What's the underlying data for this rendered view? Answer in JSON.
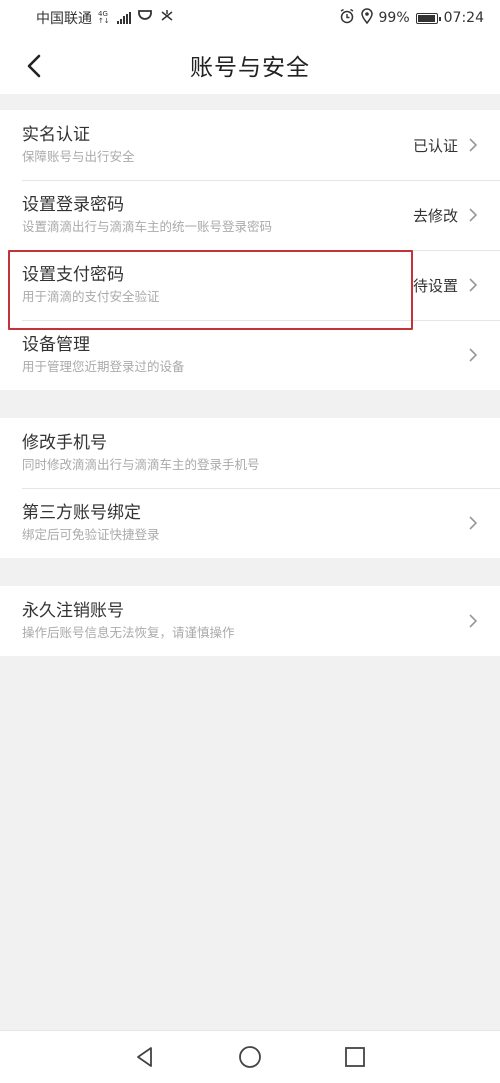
{
  "status_bar": {
    "carrier": "中国联通",
    "net_top": "4G",
    "net_bottom": "↑↓",
    "battery": "99%",
    "time": "07:24",
    "icons": [
      "signal-icon",
      "app-notification-icon",
      "alarm-icon",
      "location-icon",
      "battery-icon"
    ]
  },
  "header": {
    "title": "账号与安全",
    "back_icon": "chevron-left-icon"
  },
  "groups": [
    {
      "items": [
        {
          "title": "实名认证",
          "subtitle": "保障账号与出行安全",
          "value": "已认证"
        },
        {
          "title": "设置登录密码",
          "subtitle": "设置滴滴出行与滴滴车主的统一账号登录密码",
          "value": "去修改"
        },
        {
          "title": "设置支付密码",
          "subtitle": "用于滴滴的支付安全验证",
          "value": "待设置"
        },
        {
          "title": "设备管理",
          "subtitle": "用于管理您近期登录过的设备",
          "value": ""
        }
      ]
    },
    {
      "items": [
        {
          "title": "修改手机号",
          "subtitle": "同时修改滴滴出行与滴滴车主的登录手机号",
          "value": ""
        },
        {
          "title": "第三方账号绑定",
          "subtitle": "绑定后可免验证快捷登录",
          "value": ""
        }
      ]
    },
    {
      "items": [
        {
          "title": "永久注销账号",
          "subtitle": "操作后账号信息无法恢复，请谨慎操作",
          "value": ""
        }
      ]
    }
  ],
  "highlight": {
    "target": "set-payment-password-row",
    "color": "#c3343a"
  },
  "bottom_nav": {
    "icons": [
      "back-triangle-icon",
      "home-circle-icon",
      "recents-square-icon"
    ]
  },
  "colors": {
    "background": "#f1f1f1",
    "card": "#ffffff",
    "divider": "#e6e6e6",
    "subtitle": "#aaaaaa"
  }
}
